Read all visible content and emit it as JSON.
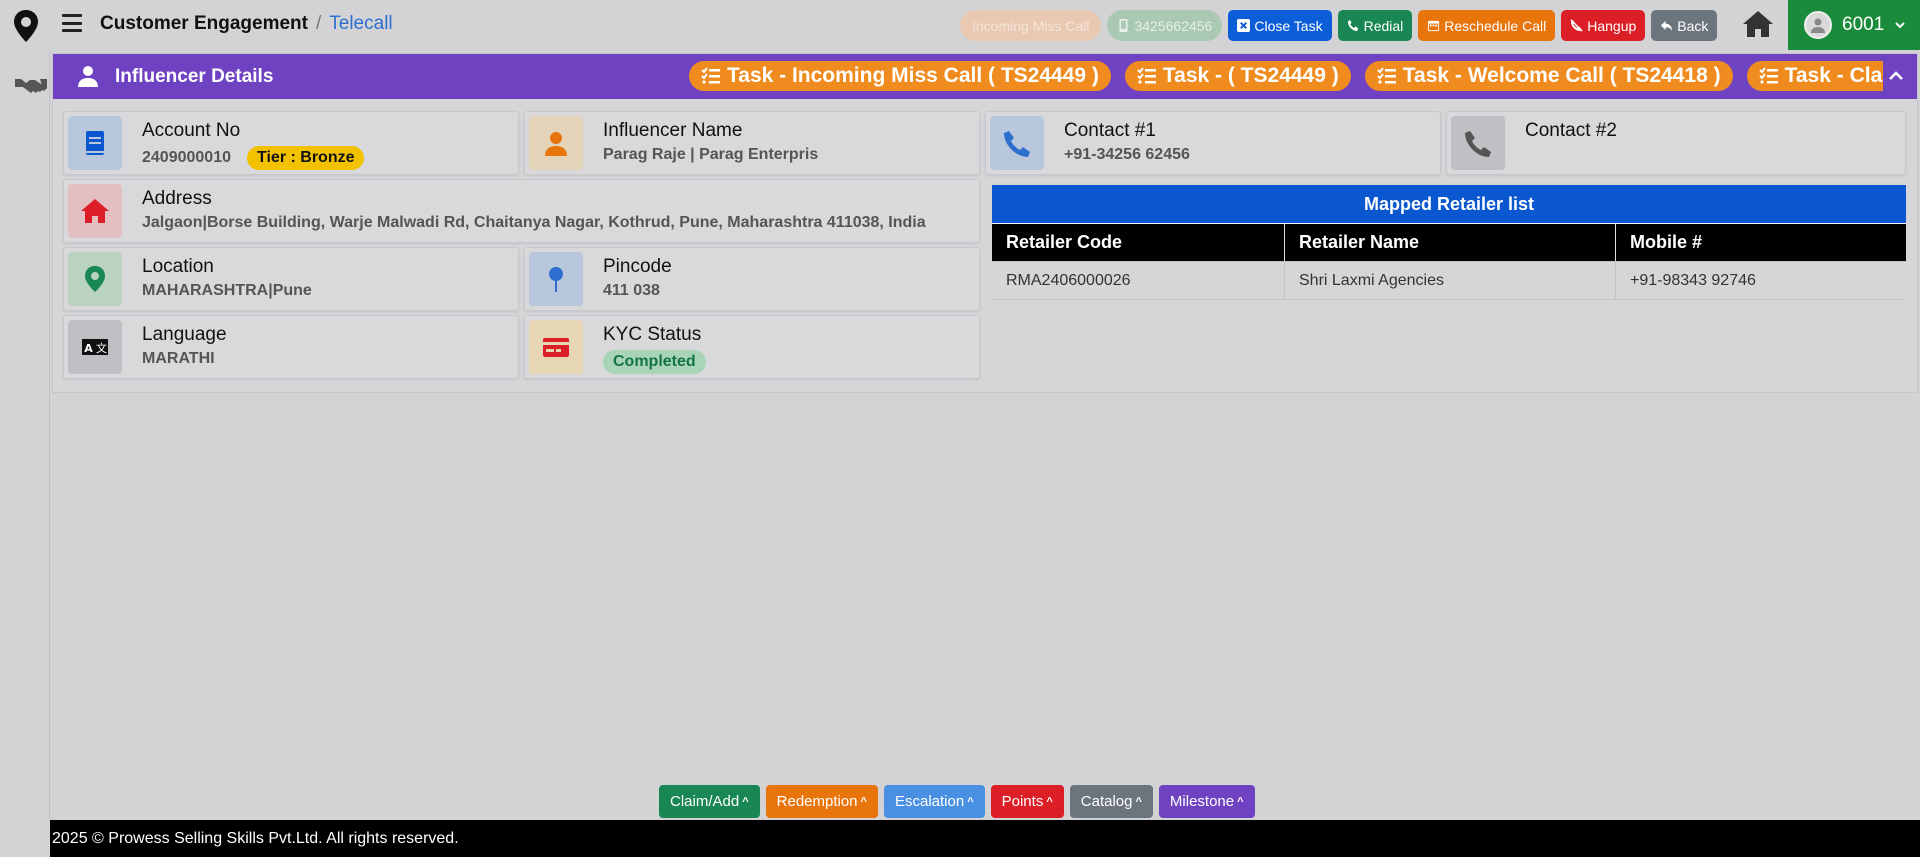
{
  "header": {
    "breadcrumb_main": "Customer Engagement",
    "breadcrumb_sep": "/",
    "breadcrumb_sub": "Telecall",
    "buttons": {
      "incoming": "Incoming Miss Call",
      "phone": "3425662456",
      "close_task": "Close Task",
      "redial": "Redial",
      "reschedule": "Reschedule Call",
      "hangup": "Hangup",
      "back": "Back"
    },
    "user_id": "6001"
  },
  "panel": {
    "title": "Influencer Details",
    "tasks": [
      "Task - Incoming Miss Call ( TS24449 )",
      "Task - ( TS24449 )",
      "Task - Welcome Call ( TS24418 )",
      "Task - Claim Verification"
    ],
    "account": {
      "label": "Account No",
      "value": "2409000010",
      "tier": "Tier : Bronze"
    },
    "influencer": {
      "label": "Influencer Name",
      "value": "Parag Raje | Parag Enterpris"
    },
    "contact1": {
      "label": "Contact #1",
      "value": "+91-34256 62456"
    },
    "contact2": {
      "label": "Contact #2",
      "value": ""
    },
    "address": {
      "label": "Address",
      "value": "Jalgaon|Borse Building, Warje Malwadi Rd, Chaitanya Nagar, Kothrud, Pune, Maharashtra 411038, India"
    },
    "location": {
      "label": "Location",
      "value": "MAHARASHTRA|Pune"
    },
    "pincode": {
      "label": "Pincode",
      "value": "411 038"
    },
    "language": {
      "label": "Language",
      "value": "MARATHI"
    },
    "kyc": {
      "label": "KYC Status",
      "value": "Completed"
    }
  },
  "retailers": {
    "title": "Mapped Retailer list",
    "headers": [
      "Retailer Code",
      "Retailer Name",
      "Mobile #"
    ],
    "rows": [
      [
        "RMA2406000026",
        "Shri Laxmi Agencies",
        "+91-98343 92746"
      ]
    ]
  },
  "bottom_buttons": [
    "Claim/Add",
    "Redemption",
    "Escalation",
    "Points",
    "Catalog",
    "Milestone"
  ],
  "footer": "2025 © Prowess Selling Skills Pvt.Ltd. All rights reserved.",
  "colors": {
    "purple": "#6f42c1",
    "orange": "#f08c1f",
    "blue": "#0b57d0",
    "green": "#198754",
    "red": "#dc1f26"
  }
}
